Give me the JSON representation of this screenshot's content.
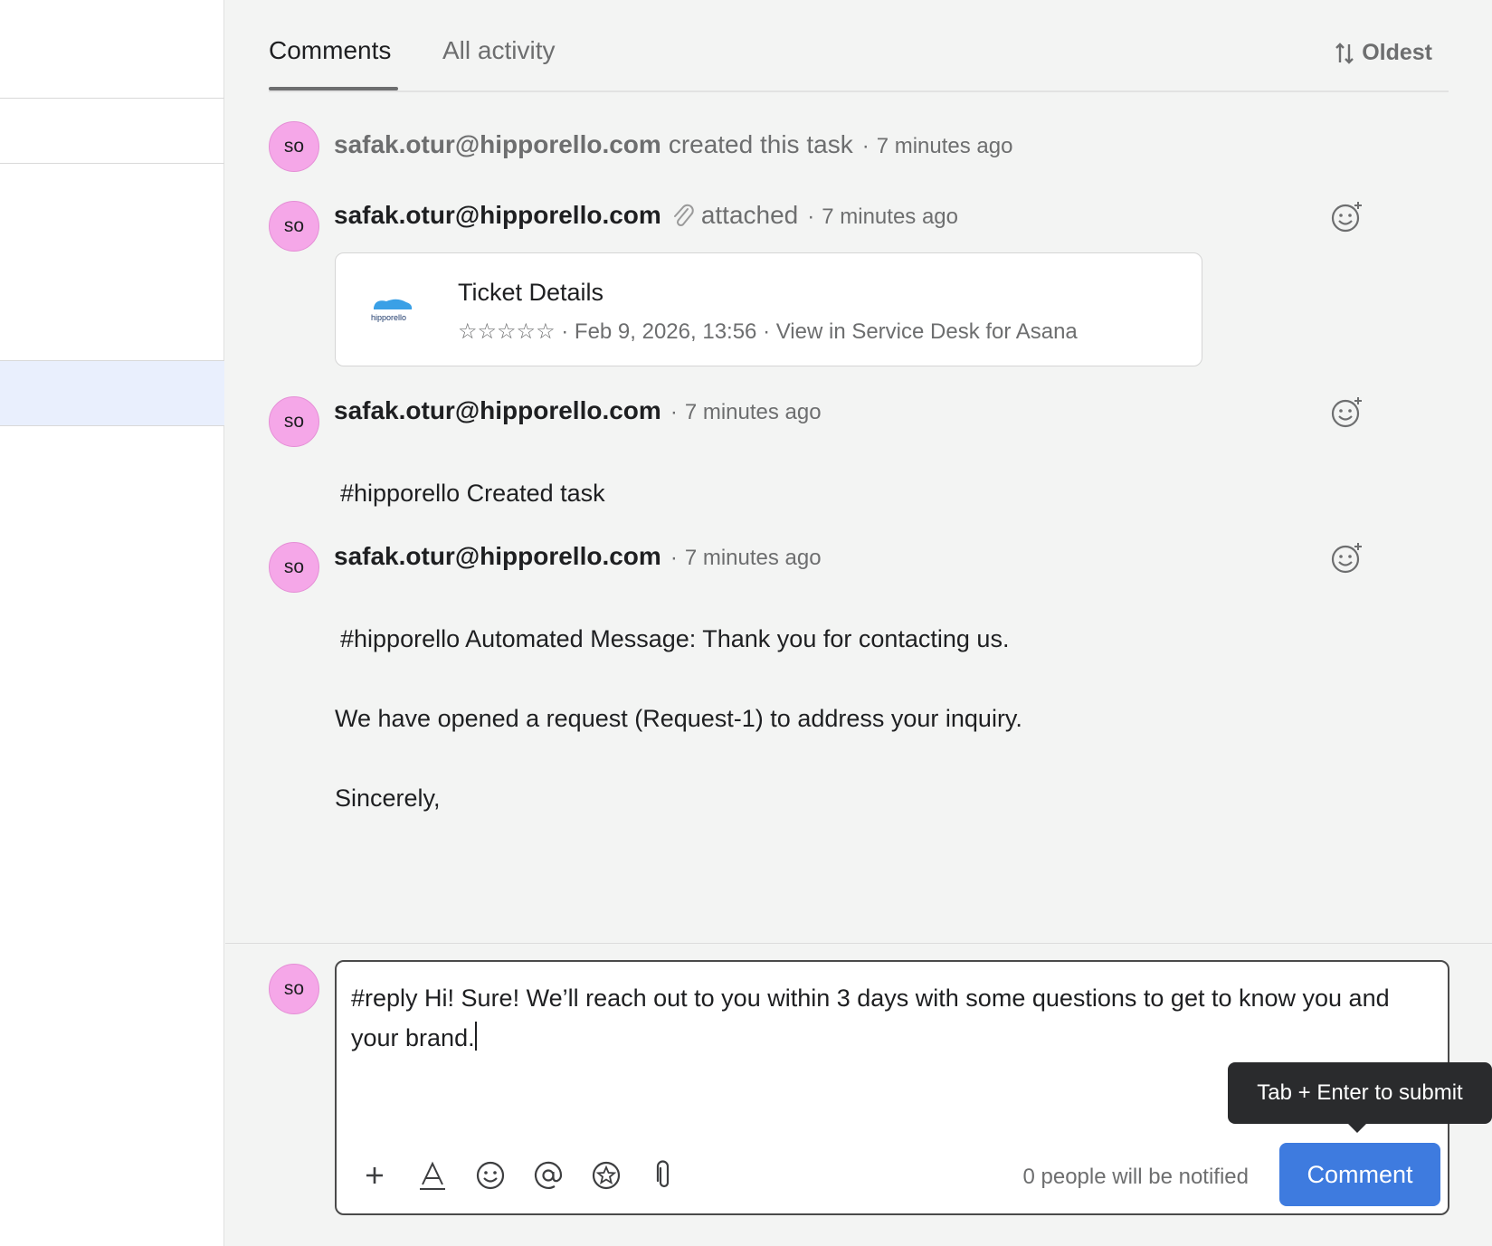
{
  "tabs": {
    "comments": "Comments",
    "all_activity": "All activity"
  },
  "sort": {
    "label": "Oldest",
    "icon": "sort-arrows-icon"
  },
  "feed": [
    {
      "initials": "so",
      "author": "safak.otur@hipporello.com",
      "action": "created this task",
      "sep": "·",
      "time": "7 minutes ago"
    },
    {
      "initials": "so",
      "author": "safak.otur@hipporello.com",
      "action": "attached",
      "sep": "·",
      "time": "7 minutes ago"
    },
    {
      "initials": "so",
      "author": "safak.otur@hipporello.com",
      "sep": "·",
      "time": "7 minutes ago",
      "body": "#hipporello Created task"
    },
    {
      "initials": "so",
      "author": "safak.otur@hipporello.com",
      "sep": "·",
      "time": "7 minutes ago",
      "body_lines": [
        "#hipporello Automated Message: Thank you for contacting us.",
        "We have opened a request (Request-1) to address your inquiry.",
        "Sincerely,"
      ]
    }
  ],
  "attachment": {
    "logo_text": "hipporello",
    "title": "Ticket Details",
    "meta": "☆☆☆☆☆ · Feb 9, 2026, 13:56 · View in Service Desk for Asana"
  },
  "composer": {
    "initials": "so",
    "text": "#reply Hi! Sure! We’ll reach out to you within 3 days with some questions to get to know you and your brand.",
    "notify": "0 people will be notified",
    "submit_label": "Comment",
    "tooltip": "Tab + Enter to submit"
  },
  "colors": {
    "accent": "#3e7bdf",
    "avatar": "#f5a7e8",
    "muted": "#6d6e6f"
  }
}
